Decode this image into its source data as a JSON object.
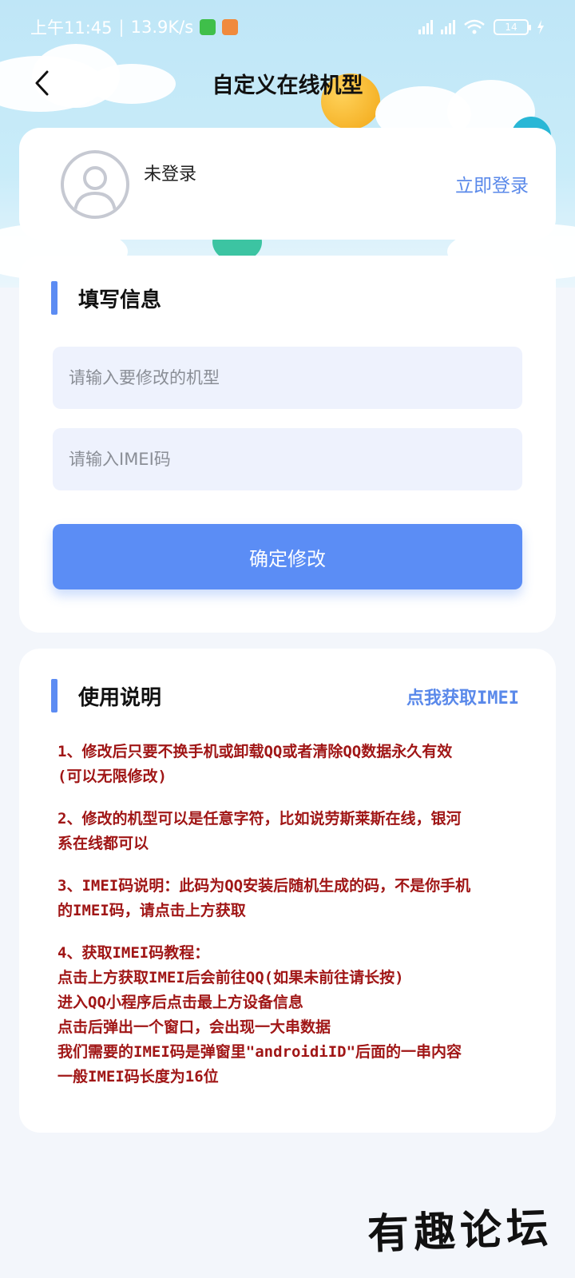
{
  "status_bar": {
    "time": "上午11:45",
    "speed": "13.9K/s",
    "battery": "14"
  },
  "nav": {
    "title": "自定义在线机型"
  },
  "user": {
    "name": "未登录",
    "login_label": "立即登录"
  },
  "form": {
    "section_title": "填写信息",
    "model_placeholder": "请输入要修改的机型",
    "imei_placeholder": "请输入IMEI码",
    "submit_label": "确定修改"
  },
  "help": {
    "section_title": "使用说明",
    "get_imei_label": "点我获取IMEI",
    "notes": [
      [
        "1、修改后只要不换手机或卸载QQ或者清除QQ数据永久有效",
        "(可以无限修改)"
      ],
      [
        "2、修改的机型可以是任意字符，比如说劳斯莱斯在线，银河",
        "系在线都可以"
      ],
      [
        "3、IMEI码说明：此码为QQ安装后随机生成的码，不是你手机",
        "的IMEI码，请点击上方获取"
      ],
      [
        "4、获取IMEI码教程：",
        "点击上方获取IMEI后会前往QQ(如果未前往请长按)",
        "进入QQ小程序后点击最上方设备信息",
        "点击后弹出一个窗口，会出现一大串数据",
        "我们需要的IMEI码是弹窗里\"androidiID\"后面的一串内容",
        "一般IMEI码长度为16位"
      ]
    ]
  },
  "watermark": "有趣论坛",
  "colors": {
    "accent": "#5b8df5",
    "link": "#5a89ea",
    "note_text": "#a01616",
    "field_bg": "#eef2fd"
  }
}
